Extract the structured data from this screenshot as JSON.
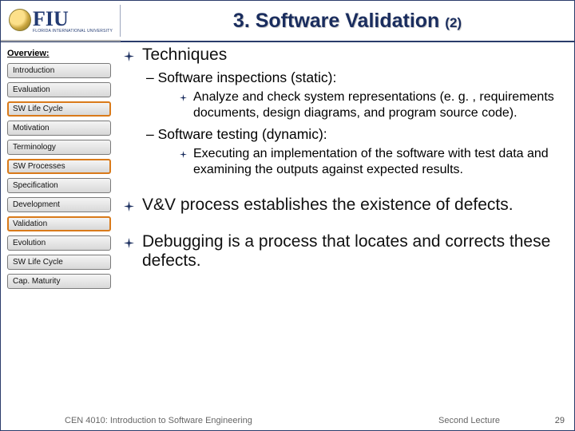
{
  "header": {
    "logo_text": "FIU",
    "logo_sub": "FLORIDA INTERNATIONAL UNIVERSITY",
    "title_main": "3. Software Validation ",
    "title_sub": "(2)"
  },
  "sidebar": {
    "title": "Overview:",
    "items": [
      {
        "label": "Introduction",
        "active": false
      },
      {
        "label": "Evaluation",
        "active": false
      },
      {
        "label": "SW Life Cycle",
        "active": true
      },
      {
        "label": "Motivation",
        "active": false
      },
      {
        "label": "Terminology",
        "active": false
      },
      {
        "label": "SW Processes",
        "active": true
      },
      {
        "label": "Specification",
        "active": false
      },
      {
        "label": "Development",
        "active": false
      },
      {
        "label": "Validation",
        "active": true
      },
      {
        "label": "Evolution",
        "active": false
      },
      {
        "label": "SW Life Cycle",
        "active": false
      },
      {
        "label": "Cap. Maturity",
        "active": false
      }
    ]
  },
  "content": {
    "b1": "Techniques",
    "b1_s1": "Software inspections (static):",
    "b1_s1_d1": "Analyze and check system representations (e. g. , requirements documents, design diagrams, and program source code).",
    "b1_s2": "Software testing (dynamic):",
    "b1_s2_d1": "Executing an implementation of the software with test data and examining the outputs against expected results.",
    "b2": "V&V process establishes the existence of defects.",
    "b3": "Debugging is a process that locates and corrects these defects."
  },
  "footer": {
    "course": "CEN 4010: Introduction to Software Engineering",
    "lecture": "Second Lecture",
    "page": "29"
  }
}
